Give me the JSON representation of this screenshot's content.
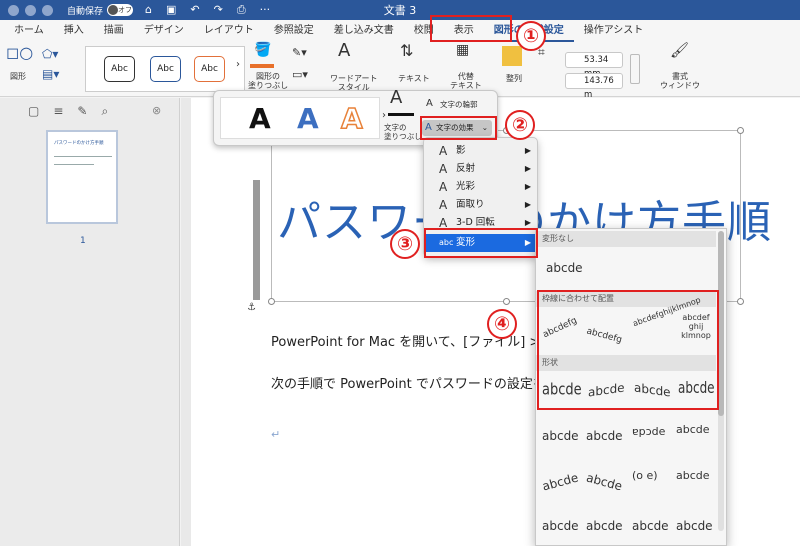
{
  "window": {
    "title": "文書 3",
    "autosave_label": "自動保存",
    "autosave_state": "オフ"
  },
  "tabs": [
    "ホーム",
    "挿入",
    "描画",
    "デザイン",
    "レイアウト",
    "参照設定",
    "差し込み文書",
    "校閲",
    "表示",
    "図形の書式設定",
    "操作アシスト"
  ],
  "ribbon": {
    "shapes_label": "図形",
    "styles": [
      "Abc",
      "Abc",
      "Abc"
    ],
    "fill_label": "図形の\n塗りつぶし",
    "wordart_label": "ワードアート\nスタイル",
    "text_label": "テキスト",
    "alt_text_label": "代替\nテキスト",
    "arrange_label": "整列",
    "height_value": "53.34 mm",
    "width_value": "143.76 m",
    "format_pane_label": "書式\nウィンドウ"
  },
  "left_pane": {
    "thumb_title": "パスワードのかけ方手順",
    "page_number": "1"
  },
  "document": {
    "heading": "パスワードのかけ方手順",
    "para1": "PowerPoint for Mac を開いて、[ファイル] > [パスワード] を選択します。",
    "para2": "次の手順で PowerPoint でパスワードの設定を行います。",
    "return_mark": "↵"
  },
  "mini_toolbar": {
    "styles": [
      "A",
      "A",
      "A"
    ],
    "text_fill_label": "文字の\n塗りつぶし",
    "text_outline_label": "文字の輪郭",
    "text_effects_label": "文字の効果"
  },
  "effects_menu": {
    "items": [
      {
        "label": "影"
      },
      {
        "label": "反射"
      },
      {
        "label": "光彩"
      },
      {
        "label": "面取り"
      },
      {
        "label": "3-D 回転"
      },
      {
        "label": "変形"
      }
    ],
    "selected": "変形"
  },
  "transform_gallery": {
    "no_transform_header": "変形なし",
    "no_transform_sample": "abcde",
    "follow_path_header": "枠線に合わせて配置",
    "warp_header": "形状",
    "samples": [
      "abcdefg",
      "abcdefg",
      "abcdefghijklmnop",
      "abcdef ghij klmnop",
      "abcde",
      "abcde",
      "abcde",
      "abcde"
    ]
  },
  "callouts": [
    "①",
    "②",
    "③",
    "④"
  ],
  "colors": {
    "accent": "#2b579a",
    "highlight": "#e02020",
    "menu_selected": "#1b6ae0",
    "heading": "#2a62b5"
  }
}
